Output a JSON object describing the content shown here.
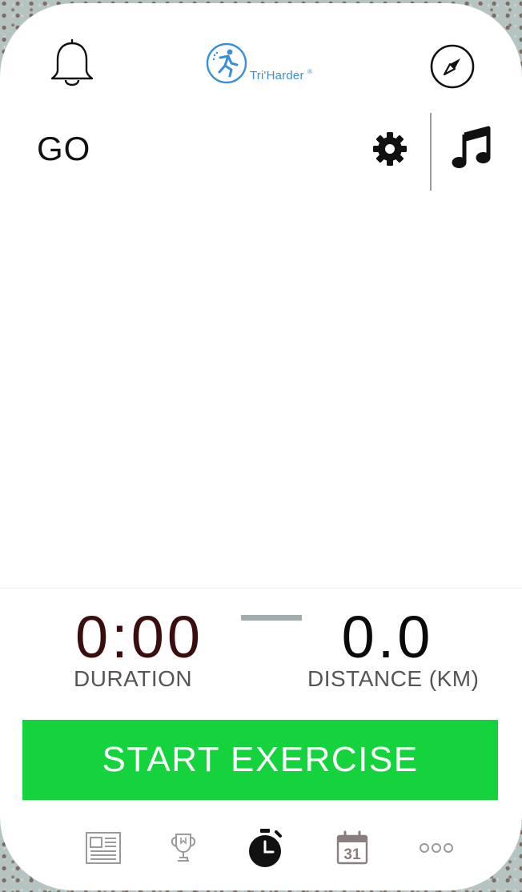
{
  "header": {
    "logo_text": "Tri'Harder",
    "logo_mark": "®",
    "left_icon": "bell-icon",
    "right_icon": "compass-icon"
  },
  "toolbar": {
    "title": "GO",
    "settings_icon": "gear-icon",
    "music_icon": "music-note-icon"
  },
  "stats": {
    "duration": {
      "value": "0:00",
      "label": "DURATION"
    },
    "distance": {
      "value": "0.0",
      "label": "DISTANCE (KM)"
    }
  },
  "actions": {
    "start_label": "START EXERCISE"
  },
  "tabbar": {
    "items": [
      {
        "icon": "newspaper-icon"
      },
      {
        "icon": "trophy-icon"
      },
      {
        "icon": "stopwatch-icon",
        "active": true
      },
      {
        "icon": "calendar-icon",
        "text": "31"
      },
      {
        "icon": "more-icon"
      }
    ]
  },
  "colors": {
    "accent_green": "#14d33c",
    "logo_blue": "#3a8fd8",
    "duration_text": "#3a0e0e",
    "tab_inactive": "#9a9a9a",
    "tab_active": "#111111"
  }
}
